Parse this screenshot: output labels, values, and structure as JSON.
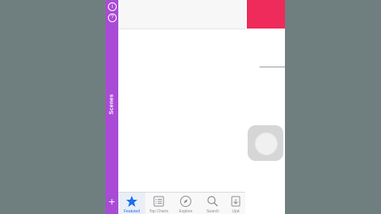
{
  "sidebar": {
    "label": "Scenes",
    "info_icon": "i",
    "help_icon": "?",
    "add_icon": "+"
  },
  "tabs": [
    {
      "label": "Featured",
      "icon": "star-icon",
      "active": true
    },
    {
      "label": "Top Charts",
      "icon": "list-icon",
      "active": false
    },
    {
      "label": "Explore",
      "icon": "compass-icon",
      "active": false
    },
    {
      "label": "Search",
      "icon": "search-icon",
      "active": false
    },
    {
      "label": "Upd",
      "icon": "updates-icon",
      "active": false
    }
  ],
  "colors": {
    "sidebar": "#a94bd6",
    "accent": "#ee2b5a",
    "active_tab": "#1e6ee6"
  }
}
